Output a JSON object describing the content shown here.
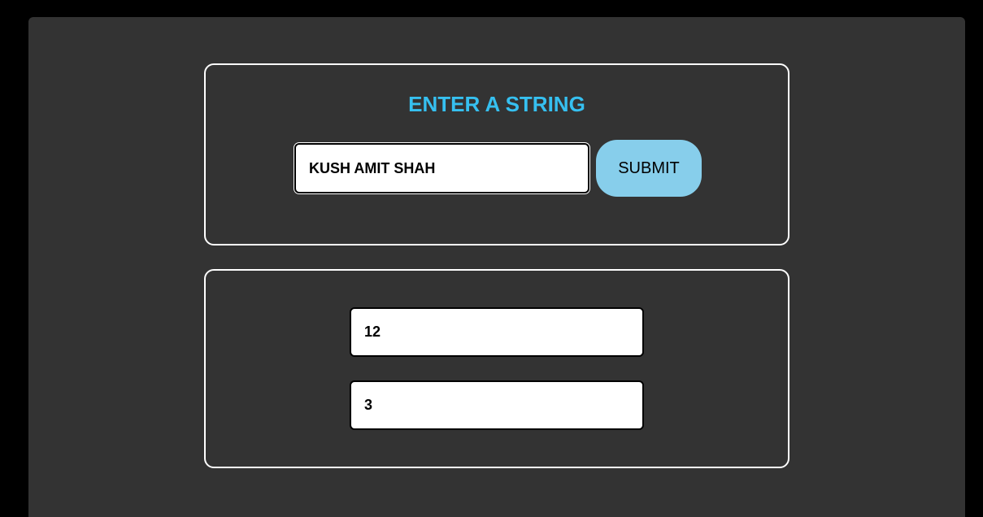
{
  "form": {
    "heading": "ENTER A STRING",
    "string_value": "KUSH AMIT SHAH",
    "submit_label": "SUBMIT"
  },
  "results": {
    "first_value": "12",
    "second_value": "3"
  },
  "colors": {
    "page_background": "#000000",
    "panel_background": "#333333",
    "card_border": "#ffffff",
    "heading_accent": "#36c0f0",
    "submit_button": "#87ceeb"
  }
}
